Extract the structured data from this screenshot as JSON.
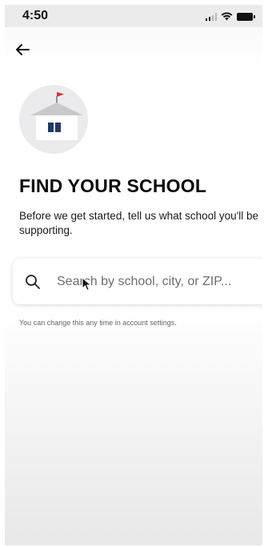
{
  "status_bar": {
    "time": "4:50"
  },
  "nav": {
    "back_icon": "arrow-left-icon"
  },
  "illustration": {
    "icon": "school-house-icon",
    "flag_color": "#e0263d",
    "roof_color": "#c9c9cc",
    "window_color": "#1f3a6b"
  },
  "main": {
    "title": "FIND YOUR SCHOOL",
    "subtitle": "Before we get started, tell us what school you'll be supporting.",
    "search": {
      "icon": "search-icon",
      "placeholder": "Search by school, city, or ZIP..."
    },
    "helper_text": "You can change this any time in account settings."
  }
}
